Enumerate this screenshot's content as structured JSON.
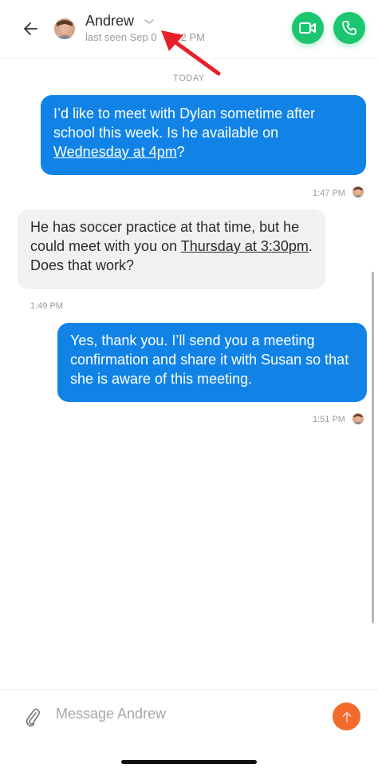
{
  "header": {
    "contact_name": "Andrew",
    "last_seen": "last seen Sep 0    1:52 PM",
    "accent_color": "#1cc671"
  },
  "icons": {
    "back": "back-arrow-icon",
    "video": "video-camera-icon",
    "phone": "phone-icon",
    "attach": "paperclip-icon",
    "send": "send-arrow-icon",
    "dropdown": "chevron-down-icon"
  },
  "conversation": {
    "day_label": "TODAY",
    "messages": [
      {
        "direction": "outgoing",
        "parts": [
          "I’d like to meet with Dylan sometime after school this week. Is he available on ",
          "Wednesday at 4pm",
          "?"
        ],
        "time": "1:47 PM"
      },
      {
        "direction": "incoming",
        "parts": [
          "He has soccer practice at that time, but he could meet with you on ",
          "Thursday at 3:30pm",
          ". Does that work?"
        ],
        "time": "1:49 PM"
      },
      {
        "direction": "outgoing",
        "text": "Yes, thank you. I’ll send you a meeting confirmation and share it with Susan so that she is aware of this meeting.",
        "time": "1:51 PM"
      }
    ]
  },
  "composer": {
    "placeholder": "Message Andrew",
    "value": ""
  },
  "colors": {
    "outgoing_bubble": "#1183e6",
    "incoming_bubble": "#f1f1f1",
    "send_button": "#f36b2a",
    "annotation_arrow": "#e8202a"
  }
}
